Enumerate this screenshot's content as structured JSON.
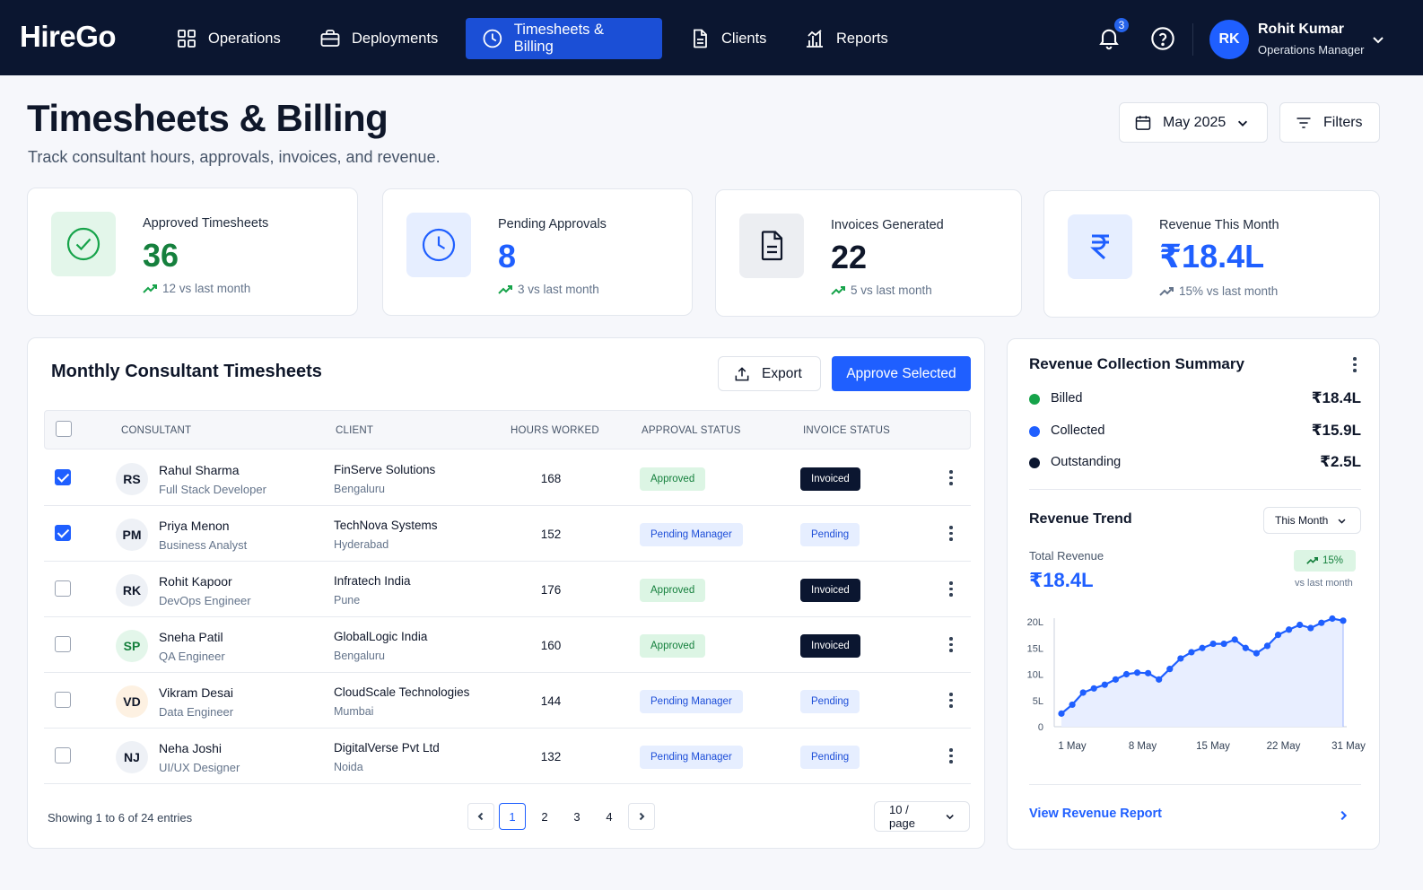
{
  "brand": "HireGo",
  "nav": {
    "items": [
      {
        "label": "Operations",
        "icon": "grid-icon"
      },
      {
        "label": "Deployments",
        "icon": "briefcase-icon"
      },
      {
        "label": "Timesheets & Billing",
        "icon": "clock-icon",
        "active": true
      },
      {
        "label": "Clients",
        "icon": "document-icon"
      },
      {
        "label": "Reports",
        "icon": "bar-chart-icon"
      }
    ],
    "notification_count": "3",
    "user": {
      "initials": "RK",
      "name": "Rohit Kumar",
      "role": "Operations Manager"
    }
  },
  "header": {
    "title": "Timesheets & Billing",
    "subtitle": "Track consultant hours, approvals, invoices, and revenue.",
    "period": "May 2025",
    "filters_label": "Filters"
  },
  "stats": [
    {
      "label": "Approved Timesheets",
      "value": "36",
      "trend": "12 vs last month",
      "color": "#15803d"
    },
    {
      "label": "Pending Approvals",
      "value": "8",
      "trend": "3 vs last month",
      "color": "#1f5fff"
    },
    {
      "label": "Invoices Generated",
      "value": "22",
      "trend": "5 vs last month",
      "color": "#0f172a"
    },
    {
      "label": "Revenue This Month",
      "value": "₹18.4L",
      "trend": "15% vs last month",
      "color": "#1f5fff"
    }
  ],
  "table": {
    "title": "Monthly Consultant Timesheets",
    "export_label": "Export",
    "approve_label": "Approve Selected",
    "columns": [
      "CONSULTANT",
      "CLIENT",
      "HOURS WORKED",
      "APPROVAL STATUS",
      "INVOICE STATUS"
    ],
    "rows": [
      {
        "checked": true,
        "initials": "RS",
        "name": "Rahul Sharma",
        "role": "Full Stack Developer",
        "client": "FinServe Solutions",
        "city": "Bengaluru",
        "hours": "168",
        "approval": "Approved",
        "invoice": "Invoiced"
      },
      {
        "checked": true,
        "initials": "PM",
        "name": "Priya Menon",
        "role": "Business Analyst",
        "client": "TechNova Systems",
        "city": "Hyderabad",
        "hours": "152",
        "approval": "Pending Manager",
        "invoice": "Pending"
      },
      {
        "checked": false,
        "initials": "RK",
        "name": "Rohit Kapoor",
        "role": "DevOps Engineer",
        "client": "Infratech India",
        "city": "Pune",
        "hours": "176",
        "approval": "Approved",
        "invoice": "Invoiced"
      },
      {
        "checked": false,
        "initials": "SP",
        "name": "Sneha Patil",
        "role": "QA Engineer",
        "client": "GlobalLogic India",
        "city": "Bengaluru",
        "hours": "160",
        "approval": "Approved",
        "invoice": "Invoiced"
      },
      {
        "checked": false,
        "initials": "VD",
        "name": "Vikram Desai",
        "role": "Data Engineer",
        "client": "CloudScale Technologies",
        "city": "Mumbai",
        "hours": "144",
        "approval": "Pending Manager",
        "invoice": "Pending"
      },
      {
        "checked": false,
        "initials": "NJ",
        "name": "Neha Joshi",
        "role": "UI/UX Designer",
        "client": "DigitalVerse Pvt Ltd",
        "city": "Noida",
        "hours": "132",
        "approval": "Pending Manager",
        "invoice": "Pending"
      }
    ],
    "avatar_colors": [
      {
        "bg": "#eef1f6",
        "fg": "#0f172a"
      },
      {
        "bg": "#eef1f6",
        "fg": "#0f172a"
      },
      {
        "bg": "#eef1f6",
        "fg": "#0f172a"
      },
      {
        "bg": "#e3f6ea",
        "fg": "#15803d"
      },
      {
        "bg": "#fdf1e2",
        "fg": "#0f172a"
      },
      {
        "bg": "#eef1f6",
        "fg": "#0f172a"
      }
    ],
    "showing": "Showing 1 to 6 of 24 entries",
    "pages": [
      "1",
      "2",
      "3",
      "4"
    ],
    "current_page": "1",
    "page_size": "10 / page"
  },
  "revenue": {
    "title": "Revenue Collection Summary",
    "legend": [
      {
        "name": "Billed",
        "value": "₹18.4L",
        "color": "#16a34a"
      },
      {
        "name": "Collected",
        "value": "₹15.9L",
        "color": "#1f5fff"
      },
      {
        "name": "Outstanding",
        "value": "₹2.5L",
        "color": "#0b1630"
      }
    ],
    "trend_title": "Revenue Trend",
    "range": "This Month",
    "total_label": "Total Revenue",
    "total_value": "₹18.4L",
    "change": "15%",
    "change_sub": "vs last month",
    "link": "View Revenue Report"
  },
  "chart_data": {
    "type": "area",
    "x_ticks": [
      "1 May",
      "8 May",
      "15 May",
      "22 May",
      "31 May"
    ],
    "y_ticks": [
      "0",
      "5L",
      "10L",
      "15L",
      "20L"
    ],
    "ylim": [
      0,
      20
    ],
    "series": [
      {
        "values": [
          2.5,
          4.2,
          6.5,
          7.3,
          8.0,
          9.0,
          10.0,
          10.3,
          10.2,
          9.0,
          11.0,
          13.0,
          14.2,
          15.0,
          15.8,
          15.8,
          16.6,
          15.0,
          14.0,
          15.4,
          17.5,
          18.5,
          19.4,
          18.8,
          19.8,
          20.6,
          20.2
        ]
      }
    ]
  }
}
